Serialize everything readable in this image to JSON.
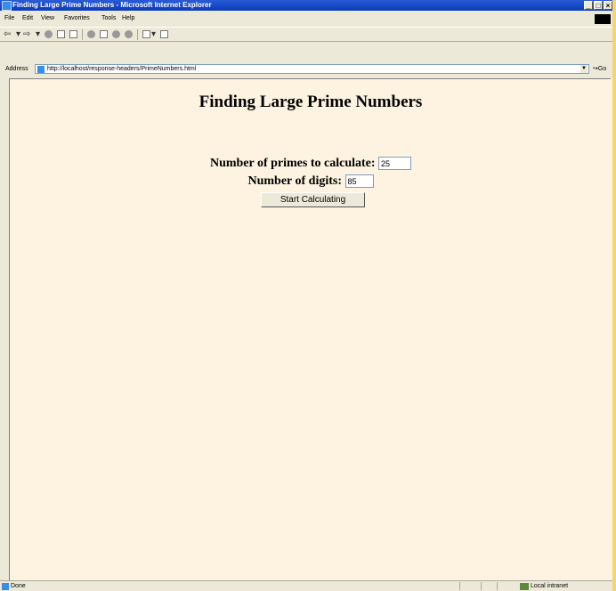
{
  "window": {
    "title": "Finding Large Prime Numbers - Microsoft Internet Explorer",
    "controls": [
      "_",
      "□",
      "×"
    ]
  },
  "menubar": {
    "items": [
      "File",
      "Edit",
      "View",
      "Favorites",
      "Tools",
      "Help"
    ]
  },
  "toolbar": {
    "icons": [
      "back-icon",
      "forward-icon",
      "stop-icon",
      "refresh-icon",
      "home-icon",
      "search-icon",
      "favorites-icon",
      "history-icon",
      "mail-icon",
      "print-icon"
    ]
  },
  "address": {
    "label": "Address",
    "url": "http://localhost/response-headers/PrimeNumbers.html",
    "go_label": "Go"
  },
  "page": {
    "heading": "Finding Large Prime Numbers",
    "primes_label": "Number of primes to calculate:",
    "primes_value": "25",
    "digits_label": "Number of digits:",
    "digits_value": "85",
    "button_label": "Start Calculating"
  },
  "status": {
    "text": "Done",
    "zone": "Local intranet"
  },
  "colors": {
    "page_background": "#fdf3e0",
    "titlebar": "#0a3bb8",
    "chrome": "#ece9d8"
  }
}
